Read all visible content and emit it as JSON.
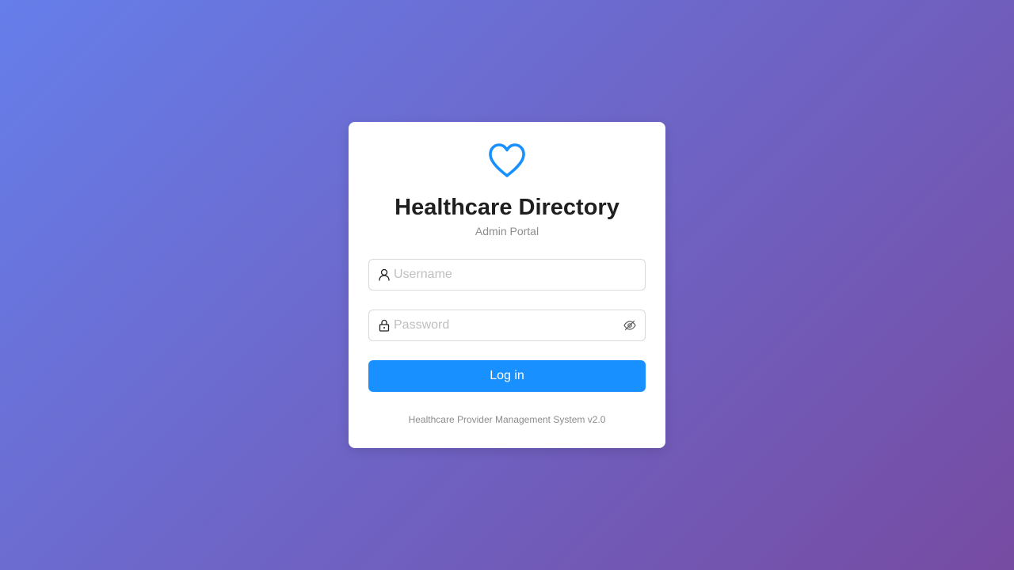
{
  "app": {
    "title": "Healthcare Directory",
    "subtitle": "Admin Portal",
    "logo_icon": "heart-icon"
  },
  "form": {
    "username": {
      "placeholder": "Username",
      "value": "",
      "icon": "user-icon"
    },
    "password": {
      "placeholder": "Password",
      "value": "",
      "icon": "lock-icon",
      "toggle_icon": "eye-invisible-icon"
    },
    "submit_label": "Log in"
  },
  "footer": {
    "text": "Healthcare Provider Management System v2.0"
  },
  "colors": {
    "background_start": "#667eea",
    "background_end": "#764ba2",
    "primary": "#1890ff",
    "card": "#ffffff"
  }
}
